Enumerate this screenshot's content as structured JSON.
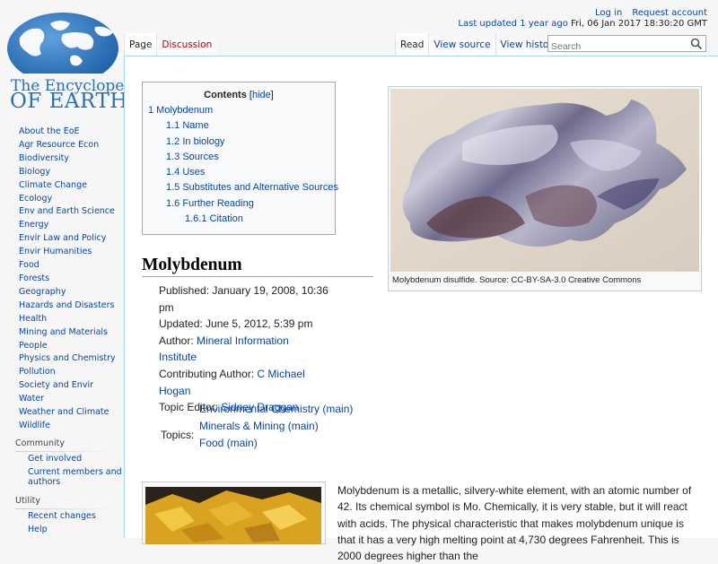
{
  "personal": {
    "login": "Log in",
    "request_account": "Request account",
    "last_updated_link": "Last updated 1 year ago",
    "last_updated_date": "Fri, 06 Jan 2017 18:30:20 GMT"
  },
  "logo": {
    "line1": "The Encyclopedia",
    "line2": "OF EARTH"
  },
  "sidebar": {
    "nav_items": [
      "About the EoE",
      "Agr Resource Econ",
      "Biodiversity",
      "Biology",
      "Climate Change",
      "Ecology",
      "Env and Earth Science",
      "Energy",
      "Envir Law and Policy",
      "Envir Humanities",
      "Food",
      "Forests",
      "Geography",
      "Hazards and Disasters",
      "Health",
      "Mining and Materials",
      "People",
      "Physics and Chemistry",
      "Pollution",
      "Society and Envir",
      "Water",
      "Weather and Climate",
      "Wildlife"
    ],
    "community_heading": "Community",
    "community_items": [
      "Get involved",
      "Current members and authors"
    ],
    "utility_heading": "Utility",
    "utility_items": [
      "Recent changes",
      "Help"
    ]
  },
  "tabs": {
    "page": "Page",
    "discussion": "Discussion",
    "read": "Read",
    "view_source": "View source",
    "view_history": "View history"
  },
  "search": {
    "placeholder": "Search"
  },
  "toc": {
    "title": "Contents",
    "hide": "hide",
    "items": [
      "1 Molybdenum",
      "1.1 Name",
      "1.2 In biology",
      "1.3 Sources",
      "1.4 Uses",
      "1.5 Substitutes and Alternative Sources",
      "1.6 Further Reading",
      "1.6.1 Citation"
    ]
  },
  "figure1": {
    "caption": "Molybdenum disulfide. Source: CC-BY-SA-3.0 Creative Commons"
  },
  "article": {
    "title": "Molybdenum",
    "published": "Published: January 19, 2008, 10:36 pm",
    "updated": "Updated: June 5, 2012, 5:39 pm",
    "author_label": "Author:",
    "author": "Mineral Information Institute",
    "contrib_label": "Contributing Author:",
    "contrib": "C Michael Hogan",
    "editor_label": "Topic Editor:",
    "editor": "Sidney Draggan",
    "topics_label": "Topics:",
    "topics": [
      "Environmental Chemistry (main)",
      "Minerals & Mining (main)",
      "Food (main)"
    ],
    "body": "Molybdenum is a metallic, silvery-white element, with an atomic number of 42. Its chemical symbol is Mo. Chemically, it is very stable, but it will react with acids. The physical characteristic that makes molybdenum unique is that it has a very high melting point at 4,730 degrees Fahrenheit. This is 2000 degrees higher than the"
  },
  "colors": {
    "link": "#0645ad",
    "logo": "#2b6fb7",
    "border": "#a7d7f9"
  }
}
